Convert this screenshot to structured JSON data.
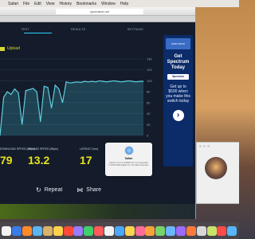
{
  "menubar": {
    "items": [
      "",
      "Safari",
      "File",
      "Edit",
      "View",
      "History",
      "Bookmarks",
      "Window",
      "Help"
    ]
  },
  "browser": {
    "url": "speedtest.net"
  },
  "speedtest": {
    "tabs": [
      "TEST",
      "RESULTS",
      "SETTINGS"
    ],
    "upload_legend": "Upload",
    "download_label": "DOWNLOAD SPEED (Mbps)",
    "download_value": "79",
    "upload_label": "UPLOAD SPEED (Mbps)",
    "upload_value": "13.2",
    "latency_label": "LATENCY (ms)",
    "latency_value": "17",
    "repeat_label": "Repeat",
    "share_label": "Share",
    "accent_color": "#30d1ff",
    "value_color": "#e6e21a"
  },
  "chart_data": {
    "type": "line",
    "x": [
      0,
      1,
      2,
      3,
      4,
      5,
      6,
      7,
      8,
      9,
      10,
      11,
      12,
      13,
      14,
      15,
      16,
      17,
      18,
      19,
      20,
      21,
      22,
      23,
      24,
      25,
      26,
      27,
      28,
      29,
      30,
      31,
      32,
      33,
      34,
      35,
      36,
      37,
      38,
      39
    ],
    "series": [
      {
        "values": [
          0,
          70,
          80,
          75,
          85,
          78,
          20,
          82,
          84,
          86,
          80,
          25,
          90,
          88,
          50,
          92,
          85,
          60,
          98,
          96,
          97,
          98,
          97,
          99,
          98,
          99,
          98,
          100,
          99,
          98,
          99,
          100,
          99,
          98,
          99,
          100,
          99,
          98,
          99,
          99
        ]
      }
    ],
    "yticks": [
      "140",
      "120",
      "100",
      "80",
      "60",
      "40",
      "20",
      "0"
    ],
    "ylim": [
      0,
      140
    ],
    "grid": true
  },
  "ad": {
    "top_text": "SPECTRUM",
    "headline": "Get Spectrum Today",
    "logo_text": "Spectrum",
    "copy": "Get up to $500 when you make this switch today",
    "cta_icon": "chevron-right-icon"
  },
  "dialog": {
    "title": "Safari",
    "text": "Version 13.1.2 (15609.3.5.1.3) Copyright © 2003-2020 Apple Inc. All rights reserved."
  },
  "dock": {
    "items": [
      "#f2f2f2",
      "#3a7be8",
      "#ff8a2a",
      "#5ab6f0",
      "#d9b36a",
      "#ffd14a",
      "#ff4a3a",
      "#9a7bff",
      "#3fcf6a",
      "#ff5a5a",
      "#f2f2f2",
      "#4ba8ff",
      "#ffd34d",
      "#ff6b9a",
      "#f8a33a",
      "#79d36b",
      "#6bb6ff",
      "#9b6bff",
      "#ff7a3d",
      "#d8d8d8",
      "#c7e36b",
      "#ff4a4a",
      "#58b6ff"
    ]
  }
}
